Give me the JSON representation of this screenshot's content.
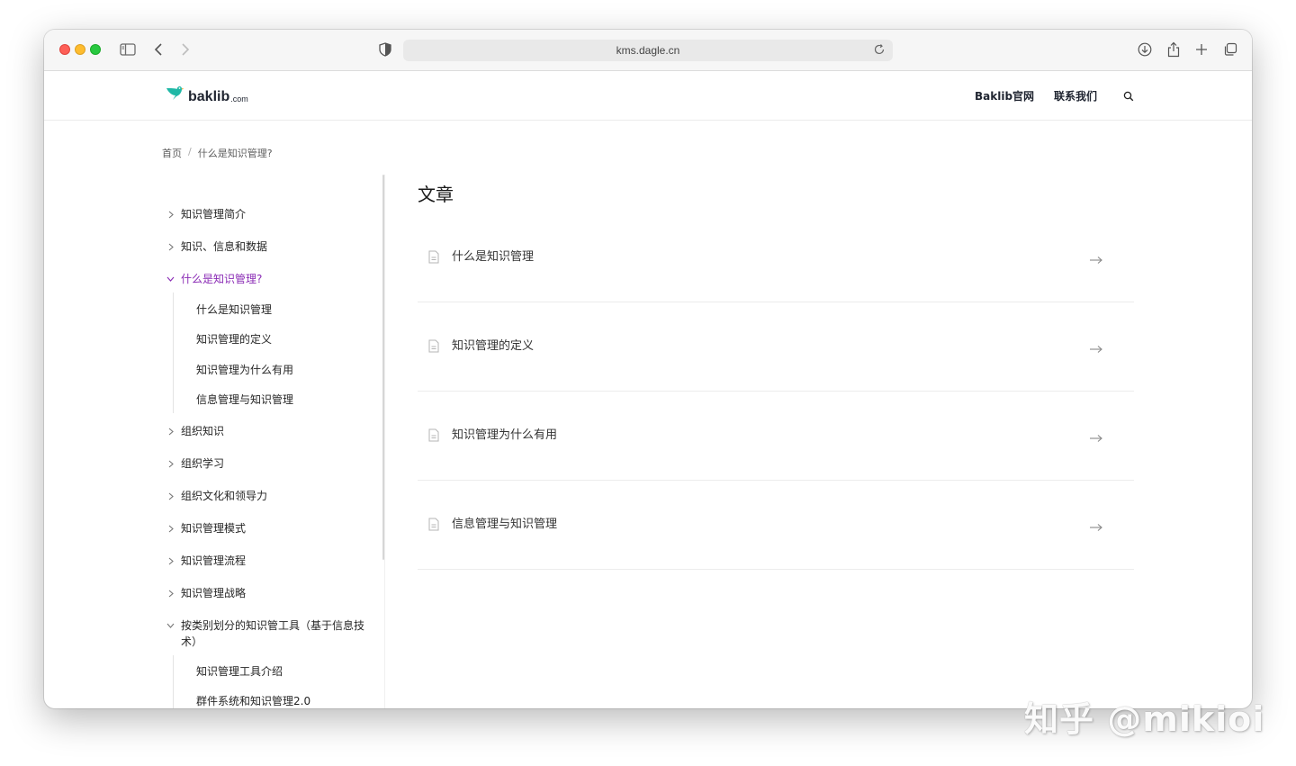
{
  "browser": {
    "url": "kms.dagle.cn"
  },
  "header": {
    "logo_text": "baklib",
    "logo_suffix": ".com",
    "nav": [
      "Baklib官网",
      "联系我们"
    ]
  },
  "breadcrumb": {
    "home": "首页",
    "separator": "/",
    "current": "什么是知识管理?"
  },
  "sidebar": {
    "items": [
      {
        "label": "知识管理简介",
        "state": "collapsed"
      },
      {
        "label": "知识、信息和数据",
        "state": "collapsed"
      },
      {
        "label": "什么是知识管理?",
        "state": "expanded-active"
      },
      {
        "label": "组织知识",
        "state": "collapsed"
      },
      {
        "label": "组织学习",
        "state": "collapsed"
      },
      {
        "label": "组织文化和领导力",
        "state": "collapsed"
      },
      {
        "label": "知识管理模式",
        "state": "collapsed"
      },
      {
        "label": "知识管理流程",
        "state": "collapsed"
      },
      {
        "label": "知识管理战略",
        "state": "collapsed"
      },
      {
        "label": "按类别划分的知识管工具（基于信息技术）",
        "state": "expanded"
      }
    ],
    "subitems_what_is_km": [
      "什么是知识管理",
      "知识管理的定义",
      "知识管理为什么有用",
      "信息管理与知识管理"
    ],
    "subitems_tools": [
      "知识管理工具介绍",
      "群件系统和知识管理2.0"
    ]
  },
  "main": {
    "title": "文章",
    "articles": [
      "什么是知识管理",
      "知识管理的定义",
      "知识管理为什么有用",
      "信息管理与知识管理"
    ]
  },
  "watermark": "知乎 @mikioi",
  "colors": {
    "accent": "#8a2bb5",
    "logo_bird": "#1fb8a6"
  }
}
